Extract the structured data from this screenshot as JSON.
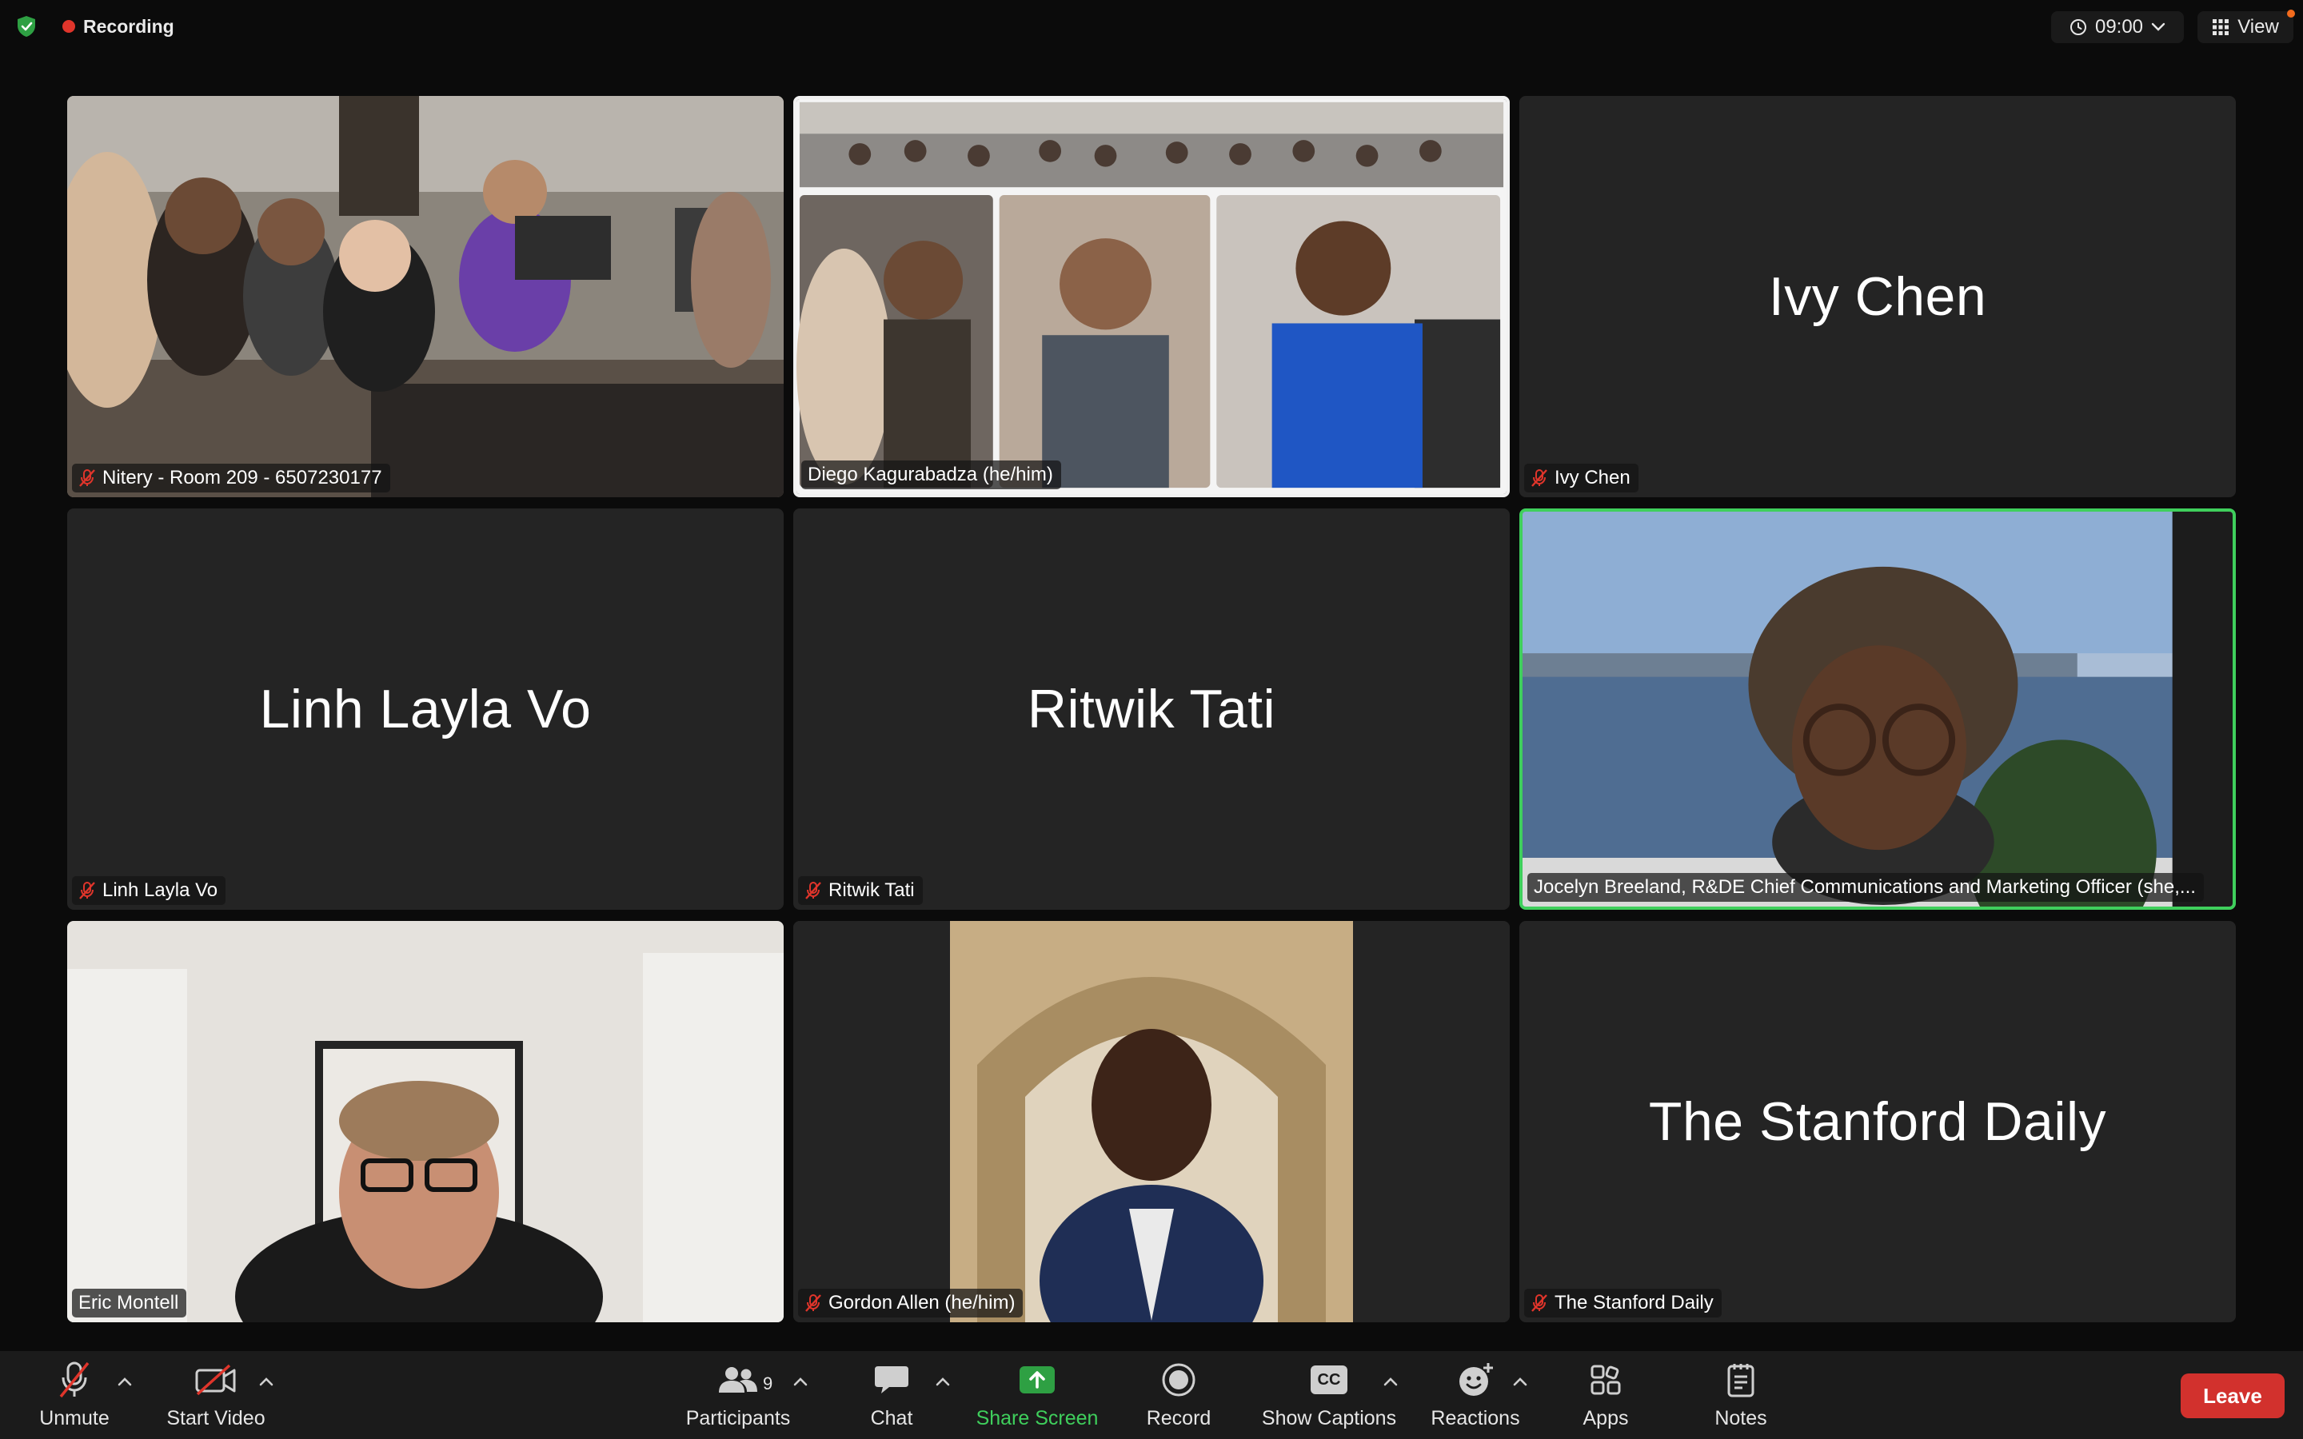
{
  "topbar": {
    "recording_label": "Recording",
    "timer": "09:00",
    "view_label": "View"
  },
  "tiles": [
    {
      "name": "Nitery - Room 209 - 6507230177",
      "muted": true,
      "type": "video"
    },
    {
      "name": "Diego Kagurabadza (he/him)",
      "muted": false,
      "type": "video"
    },
    {
      "name": "Ivy Chen",
      "display_name": "Ivy Chen",
      "muted": true,
      "type": "name"
    },
    {
      "name": "Linh Layla Vo",
      "display_name": "Linh Layla Vo",
      "muted": true,
      "type": "name"
    },
    {
      "name": "Ritwik Tati",
      "display_name": "Ritwik Tati",
      "muted": true,
      "type": "name"
    },
    {
      "name": "Jocelyn Breeland, R&DE Chief Communications and Marketing Officer (she,...",
      "muted": false,
      "type": "video",
      "active_speaker": true
    },
    {
      "name": "Eric Montell",
      "muted": false,
      "type": "video"
    },
    {
      "name": "Gordon Allen (he/him)",
      "muted": true,
      "type": "video"
    },
    {
      "name": "The Stanford Daily",
      "display_name": "The Stanford Daily",
      "muted": true,
      "type": "name"
    }
  ],
  "toolbar": {
    "unmute": "Unmute",
    "start_video": "Start Video",
    "participants": "Participants",
    "participants_count": "9",
    "chat": "Chat",
    "share_screen": "Share Screen",
    "record": "Record",
    "show_captions": "Show Captions",
    "cc_glyph": "CC",
    "reactions": "Reactions",
    "apps": "Apps",
    "notes": "Notes",
    "leave": "Leave"
  },
  "colors": {
    "background": "#0b0b0b",
    "tile": "#242424",
    "active_speaker": "#3fcf5c",
    "recording": "#e0352b",
    "leave": "#d2312d",
    "share_screen": "#3fcf5c"
  }
}
